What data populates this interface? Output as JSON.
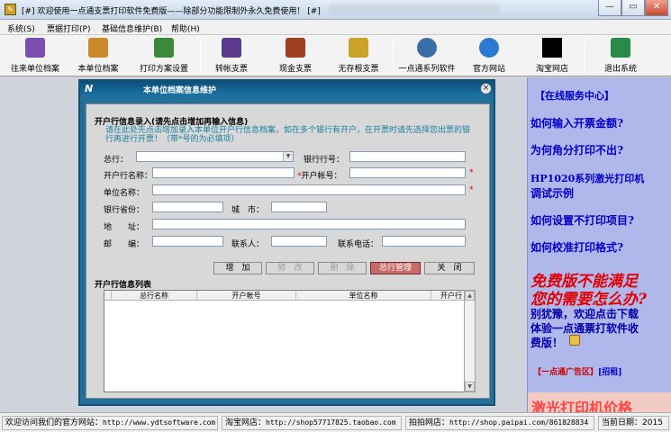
{
  "window": {
    "title": "[#] 欢迎使用一点通支票打印软件免费版——除部分功能限制外永久免费使用！ [#]",
    "min_glyph": "—",
    "max_glyph": "▭",
    "close_glyph": "✕"
  },
  "menu": [
    "系统(S)",
    "票据打印(P)",
    "基础信息维护(B)",
    "帮助(H)"
  ],
  "toolbar": [
    {
      "label": "往来单位档案",
      "icon": "people-icon",
      "color": "#7a4fb0"
    },
    {
      "label": "本单位档案",
      "icon": "person-icon",
      "color": "#c9882a"
    },
    {
      "label": "打印方案设置",
      "icon": "print-settings-icon",
      "color": "#3a8a3a"
    },
    {
      "label": "转帐支票",
      "icon": "transfer-check-icon",
      "color": "#5a3a8a"
    },
    {
      "label": "现金支票",
      "icon": "cash-check-icon",
      "color": "#a04020"
    },
    {
      "label": "无存根支票",
      "icon": "stubless-check-icon",
      "color": "#c9a227"
    },
    {
      "label": "一点通系列软件",
      "icon": "software-icon",
      "color": "#3a6ea8"
    },
    {
      "label": "官方网站",
      "icon": "ie-icon",
      "color": "#2a7ad4"
    },
    {
      "label": "淘宝网店",
      "icon": "shop-icon",
      "color": "#000000"
    },
    {
      "label": "退出系统",
      "icon": "exit-icon",
      "color": "#2a8a4a"
    }
  ],
  "dialog": {
    "title": "本单位档案信息维护",
    "logo": "N",
    "close_glyph": "×",
    "group_title": "开户行信息录入(请先点击增加再输入信息)",
    "hint": "请在此处先点击增加录入本单位开户行信息档案，如在多个银行有开户，在开票时请先选择您出票的银行再进行开票！（带*号的为必填项）",
    "fields": {
      "head_bank": "总行：",
      "bank_no": "银行行号：",
      "bank_name": "开户行名称：",
      "account_no": "开户帐号：",
      "unit_name": "单位名称：",
      "province": "银行省份：",
      "city": "城　市：",
      "address": "地　　址：",
      "postcode": "邮　　编：",
      "contact": "联系人：",
      "phone": "联系电话："
    },
    "required_mark": "*",
    "buttons": {
      "add": "增　加",
      "edit": "修　改",
      "delete": "删　除",
      "head_office": "总行管理",
      "close": "关　闭"
    },
    "list_title": "开户行信息列表",
    "columns": [
      "总行名称",
      "开户帐号",
      "单位名称",
      "开户行"
    ]
  },
  "right_panel": {
    "header": "【在线服务中心】",
    "links": [
      "如何输入开票金额?",
      "为何角分打印不出?",
      "HP1020系列激光打印机",
      "调试示例",
      "如何设置不打印项目?",
      "如何校准打印格式?"
    ],
    "promo_lines": [
      "免费版不能满足",
      "您的需要怎么办?"
    ],
    "promo_text": [
      "别犹豫，欢迎点击下载",
      "体验一点通票打软件收",
      "费版！"
    ],
    "ad_label": "【一点通广告区】",
    "ad_link": "[招租]",
    "bottom_text": "激光打印机价格"
  },
  "statusbar": {
    "site_label": "欢迎访问我们的官方网站：",
    "site_url": "http://www.ydtsoftware.com",
    "taobao_label": "淘宝网店：",
    "taobao_url": "http://shop57717825.taobao.com",
    "paipai_label": "拍拍网店：",
    "paipai_url": "http://shop.paipai.com/861828834",
    "date_label": "当前日期：",
    "date_value": "2015"
  }
}
